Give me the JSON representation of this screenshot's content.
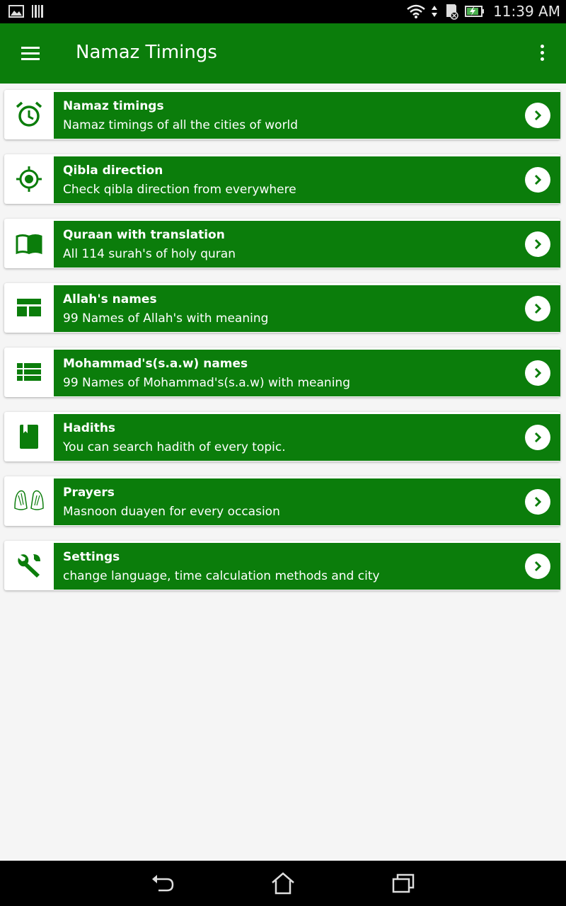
{
  "status_bar": {
    "time": "11:39 AM",
    "icons": [
      "image-icon",
      "barcode-icon",
      "wifi-icon",
      "data-arrows-icon",
      "sd-card-icon",
      "battery-charging-icon"
    ]
  },
  "app_bar": {
    "title": "Namaz Timings",
    "menu_icon": "hamburger-menu-icon",
    "overflow_icon": "more-vert-icon"
  },
  "menu": [
    {
      "icon": "alarm-clock-icon",
      "title": "Namaz timings",
      "subtitle": "Namaz timings of all the cities of world"
    },
    {
      "icon": "crosshair-target-icon",
      "title": "Qibla direction",
      "subtitle": "Check qibla direction from everywhere"
    },
    {
      "icon": "open-book-icon",
      "title": "Quraan with translation",
      "subtitle": "All 114 surah's of holy quran"
    },
    {
      "icon": "grid-layout-icon",
      "title": "Allah's names",
      "subtitle": "99 Names of Allah's with meaning"
    },
    {
      "icon": "list-view-icon",
      "title": "Mohammad's(s.a.w) names",
      "subtitle": "99 Names of Mohammad's(s.a.w) with meaning"
    },
    {
      "icon": "book-bookmark-icon",
      "title": "Hadiths",
      "subtitle": "You can search hadith of every topic."
    },
    {
      "icon": "praying-hands-icon",
      "title": "Prayers",
      "subtitle": "Masnoon duayen for every occasion"
    },
    {
      "icon": "wrench-icon",
      "title": "Settings",
      "subtitle": "change language, time calculation methods and city"
    }
  ],
  "nav_bar": {
    "icons": [
      "back-icon",
      "home-icon",
      "recent-apps-icon"
    ]
  },
  "colors": {
    "primary": "#0b7d0b",
    "background": "#f5f5f5",
    "icon_green": "#0b7d0b"
  }
}
